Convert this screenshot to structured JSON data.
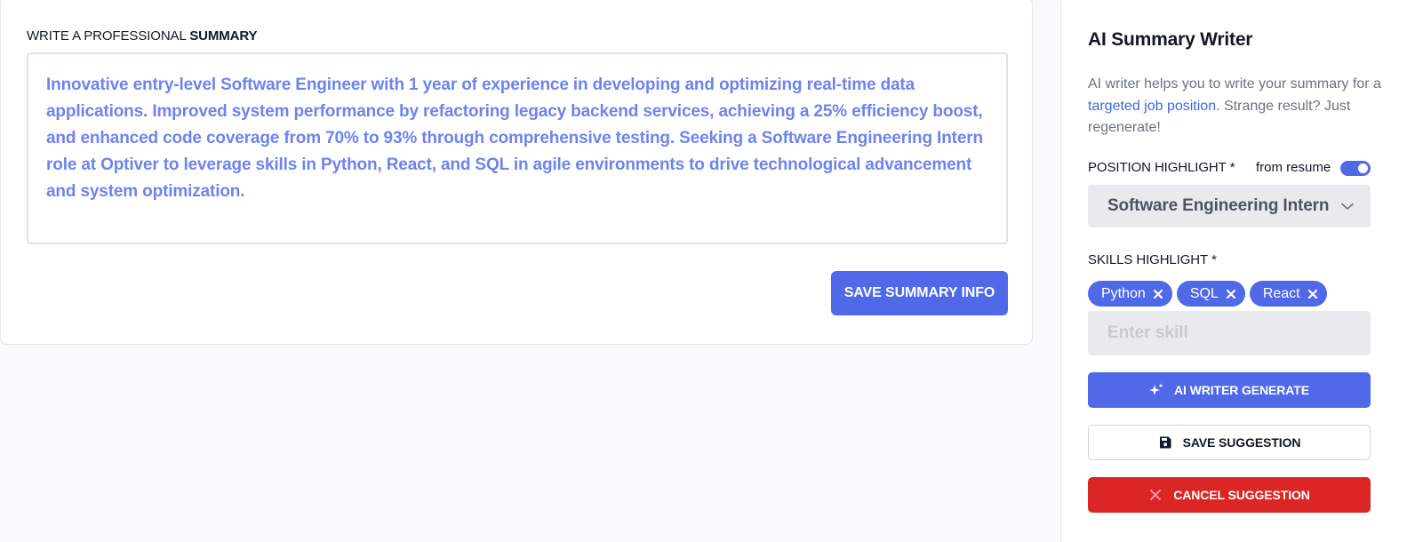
{
  "summary": {
    "title_prefix": "WRITE A PROFESSIONAL ",
    "title_bold": "SUMMARY",
    "text": "Innovative entry-level Software Engineer with 1 year of experience in developing and optimizing real-time data applications. Improved system performance by refactoring legacy backend services, achieving a 25% efficiency boost, and enhanced code coverage from 70% to 93% through comprehensive testing. Seeking a Software Engineering Intern role at Optiver to leverage skills in Python, React, and SQL in agile environments to drive technological advancement and system optimization.",
    "save_label": "SAVE SUMMARY INFO"
  },
  "ai_writer": {
    "title": "AI Summary Writer",
    "desc_part1": "AI writer helps you to write your summary for a ",
    "desc_link": "targeted job position",
    "desc_part2": ". Strange result? Just regenerate!",
    "position_label": "POSITION HIGHLIGHT",
    "required_mark": "*",
    "from_resume_label": "from resume",
    "from_resume_on": true,
    "position_value": "Software Engineering Intern",
    "skills_label": "SKILLS HIGHLIGHT",
    "skills": [
      "Python",
      "SQL",
      "React"
    ],
    "skill_placeholder": "Enter skill",
    "generate_label": "AI WRITER GENERATE",
    "save_suggestion_label": "SAVE SUGGESTION",
    "cancel_suggestion_label": "CANCEL SUGGESTION"
  },
  "colors": {
    "accent": "#4f69e8",
    "summary_text": "#6f83ee",
    "link": "#4166e6",
    "danger": "#dc2626"
  },
  "icons": {
    "toggle": "toggle-switch-icon",
    "select_chevron": "chevron-down-icon",
    "chip_remove": "close-icon",
    "generate": "sparkles-icon",
    "save": "floppy-disk-icon",
    "cancel": "close-icon"
  }
}
